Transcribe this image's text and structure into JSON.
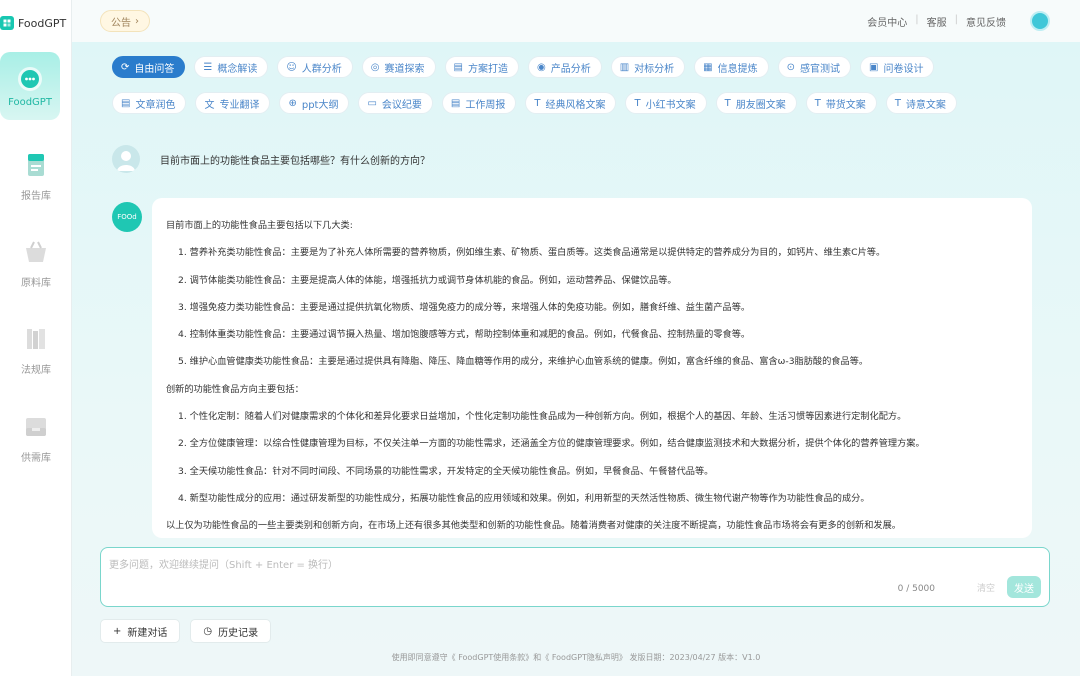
{
  "app": {
    "name": "FoodGPT"
  },
  "sidebar": {
    "items": [
      {
        "label": "FoodGPT",
        "icon": "chat-bot-icon"
      },
      {
        "label": "报告库",
        "icon": "report-icon"
      },
      {
        "label": "原料库",
        "icon": "basket-icon"
      },
      {
        "label": "法规库",
        "icon": "books-icon"
      },
      {
        "label": "供需库",
        "icon": "inbox-icon"
      }
    ]
  },
  "topbar": {
    "notice": "公告",
    "links": [
      "会员中心",
      "客服",
      "意见反馈"
    ]
  },
  "tabs_row1": [
    "自由问答",
    "概念解读",
    "人群分析",
    "赛道探索",
    "方案打造",
    "产品分析",
    "对标分析",
    "信息提炼",
    "感官测试",
    "问卷设计"
  ],
  "tabs_row2": [
    "文章润色",
    "专业翻译",
    "ppt大纲",
    "会议纪要",
    "工作周报",
    "经典风格文案",
    "小红书文案",
    "朋友圈文案",
    "带货文案",
    "诗意文案"
  ],
  "conversation": {
    "question": "目前市面上的功能性食品主要包括哪些？有什么创新的方向？",
    "answer_avatar": "FOOd",
    "answer": [
      "目前市面上的功能性食品主要包括以下几大类:",
      "1. 营养补充类功能性食品：主要是为了补充人体所需要的营养物质，例如维生素、矿物质、蛋白质等。这类食品通常是以提供特定的营养成分为目的，如钙片、维生素C片等。",
      "2. 调节体能类功能性食品：主要是提高人体的体能，增强抵抗力或调节身体机能的食品。例如，运动营养品、保健饮品等。",
      "3. 增强免疫力类功能性食品：主要是通过提供抗氧化物质、增强免疫力的成分等，来增强人体的免疫功能。例如，膳食纤维、益生菌产品等。",
      "4. 控制体重类功能性食品：主要通过调节摄入热量、增加饱腹感等方式，帮助控制体重和减肥的食品。例如，代餐食品、控制热量的零食等。",
      "5. 维护心血管健康类功能性食品：主要是通过提供具有降脂、降压、降血糖等作用的成分，来维护心血管系统的健康。例如，富含纤维的食品、富含ω-3脂肪酸的食品等。",
      "创新的功能性食品方向主要包括：",
      "1. 个性化定制：随着人们对健康需求的个体化和差异化要求日益增加，个性化定制功能性食品成为一种创新方向。例如，根据个人的基因、年龄、生活习惯等因素进行定制化配方。",
      "2. 全方位健康管理：以综合性健康管理为目标，不仅关注单一方面的功能性需求，还涵盖全方位的健康管理要求。例如，结合健康监测技术和大数据分析，提供个体化的营养管理方案。",
      "3. 全天候功能性食品：针对不同时间段、不同场景的功能性需求，开发特定的全天候功能性食品。例如，早餐食品、午餐替代品等。",
      "4. 新型功能性成分的应用：通过研发新型的功能性成分，拓展功能性食品的应用领域和效果。例如，利用新型的天然活性物质、微生物代谢产物等作为功能性食品的成分。",
      "以上仅为功能性食品的一些主要类别和创新方向，在市场上还有很多其他类型和创新的功能性食品。随着消费者对健康的关注度不断提高，功能性食品市场将会有更多的创新和发展。"
    ]
  },
  "input": {
    "placeholder": "更多问题，欢迎继续提问（Shift + Enter = 换行）",
    "counter": "0 / 5000",
    "clear_label": "清空",
    "send_label": "发送"
  },
  "actions": {
    "new_chat": "新建对话",
    "history": "历史记录"
  },
  "footer": "使用即同意遵守《 FoodGPT使用条款》和《 FoodGPT隐私声明》 发版日期：2023/04/27 版本：V1.0",
  "colors": {
    "accent": "#1fc7b3",
    "tab_blue": "#2a7ccc"
  }
}
